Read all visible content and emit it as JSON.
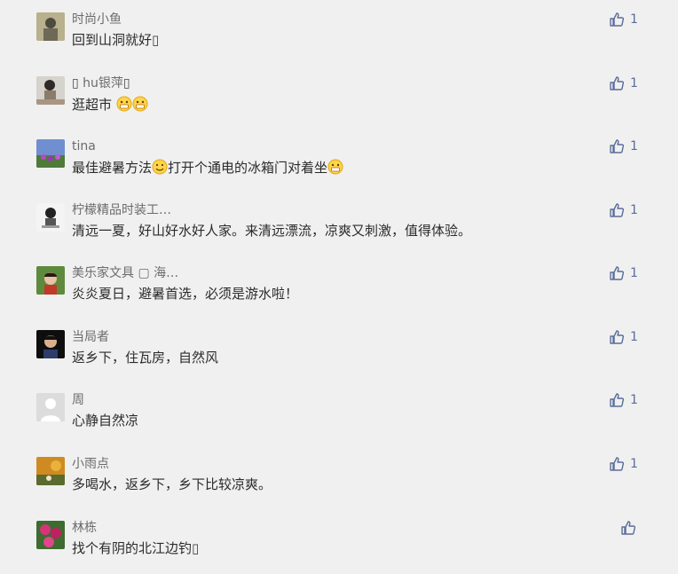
{
  "comments": [
    {
      "name": "时尚小鱼",
      "text": "回到山洞就好",
      "likes": "1"
    },
    {
      "name": " hu银萍",
      "text": "逛超市",
      "likes": "1"
    },
    {
      "name": "tina",
      "text_parts": [
        "最佳避暑方法",
        "打开个通电的冰箱门对着坐"
      ],
      "likes": "1"
    },
    {
      "name": "柠檬精品时装工…",
      "text": "清远一夏，好山好水好人家。来清远漂流，凉爽又刺激，值得体验。",
      "likes": "1"
    },
    {
      "name": "美乐家文具 ▢ 海…",
      "text": "炎炎夏日，避暑首选，必须是游水啦！",
      "likes": "1"
    },
    {
      "name": "当局者",
      "text": "返乡下，住瓦房，自然风",
      "likes": "1"
    },
    {
      "name": "周",
      "text": "心静自然凉",
      "likes": "1"
    },
    {
      "name": "小雨点",
      "text": "多喝水，返乡下，乡下比较凉爽。",
      "likes": "1"
    },
    {
      "name": "林栋",
      "text": "找个有阴的北江边钓",
      "likes": ""
    }
  ],
  "icons": {
    "like": "thumbs-up-icon",
    "grin": "grin-emoji-icon",
    "smile": "smile-emoji-icon"
  },
  "colors": {
    "accent": "#5a6c99",
    "background": "#f0f0f0"
  }
}
